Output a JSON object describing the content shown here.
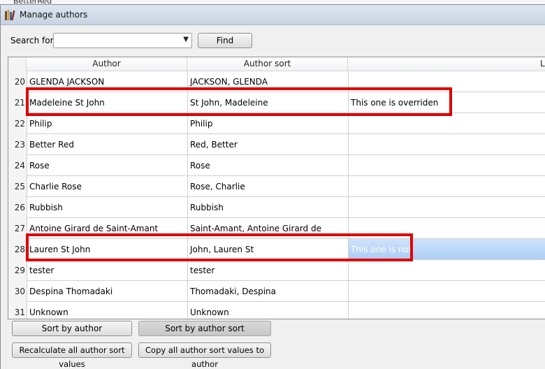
{
  "background": {
    "window_text": "BetterRed"
  },
  "window": {
    "title": "Manage authors"
  },
  "search": {
    "label": "Search for:",
    "value": "",
    "placeholder": "",
    "find_label": "Find"
  },
  "table": {
    "columns": [
      "Author",
      "Author sort",
      "Lir"
    ],
    "rows": [
      {
        "num": "20",
        "author": "GLENDA JACKSON",
        "sort": "JACKSON, GLENDA",
        "link": ""
      },
      {
        "num": "21",
        "author": "Madeleine St John",
        "sort": "St John, Madeleine",
        "link": "This one is overriden"
      },
      {
        "num": "22",
        "author": "Philip",
        "sort": "Philip",
        "link": ""
      },
      {
        "num": "23",
        "author": "Better Red",
        "sort": "Red, Better",
        "link": ""
      },
      {
        "num": "24",
        "author": "Rose",
        "sort": "Rose",
        "link": ""
      },
      {
        "num": "25",
        "author": "Charlie Rose",
        "sort": "Rose, Charlie",
        "link": ""
      },
      {
        "num": "26",
        "author": "Rubbish",
        "sort": "Rubbish",
        "link": ""
      },
      {
        "num": "27",
        "author": "Antoine Girard de Saint-Amant",
        "sort": "Saint-Amant, Antoine Girard de",
        "link": ""
      },
      {
        "num": "28",
        "author": "Lauren St John",
        "sort": "John, Lauren St",
        "link": "This one is not"
      },
      {
        "num": "29",
        "author": "tester",
        "sort": "tester",
        "link": ""
      },
      {
        "num": "30",
        "author": "Despina Thomadaki",
        "sort": "Thomadaki, Despina",
        "link": ""
      },
      {
        "num": "31",
        "author": "Unknown",
        "sort": "Unknown",
        "link": ""
      }
    ]
  },
  "buttons": {
    "sort_by_author": "Sort by author",
    "sort_by_author_sort": "Sort by author sort",
    "recalculate": "Recalculate all author sort values",
    "copy": "Copy all author sort values to author"
  },
  "colors": {
    "annotation": "#e00000",
    "selection": "#a9cdf5"
  }
}
